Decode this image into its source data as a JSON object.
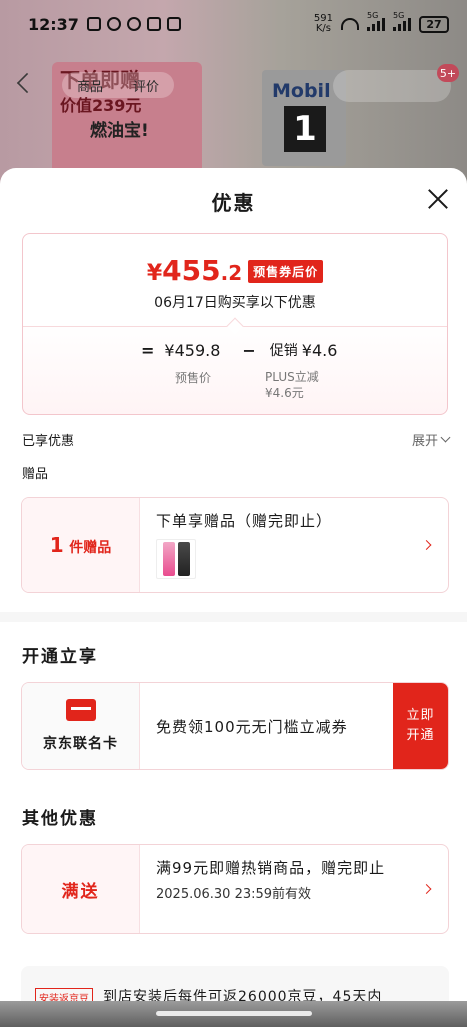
{
  "status_bar": {
    "time": "12:37",
    "net_speed_value": "591",
    "net_speed_unit": "K/s",
    "signal_1_label": "5G",
    "signal_2_label": "5G",
    "battery": "27"
  },
  "background": {
    "tab_product": "商品",
    "tab_review": "评价",
    "promo_line1": "下单即赠",
    "promo_line2": "价值239元",
    "promo_line3": "燃油宝!",
    "brand_text": "Mobil",
    "brand_number": "1",
    "cart_badge": "5+"
  },
  "sheet": {
    "title": "优惠",
    "price_card": {
      "currency": "¥",
      "price_integer": "455",
      "price_decimal": ".2",
      "price_tag": "预售券后价",
      "date_text": "06月17日购买享以下优惠",
      "eq": "=",
      "presale_price": "¥459.8",
      "minus": "−",
      "promo_label": "促销",
      "promo_amount": "¥4.6",
      "presale_label": "预售价",
      "plus_label": "PLUS立减",
      "plus_amount": "¥4.6元"
    },
    "enjoyed_label": "已享优惠",
    "expand_label": "展开",
    "gift_heading": "赠品",
    "gift_card": {
      "count": "1",
      "unit": "件赠品",
      "title": "下单享赠品（赠完即止）"
    },
    "open_section_title": "开通立享",
    "jd_card": {
      "name": "京东联名卡",
      "desc": "免费领100元无门槛立减券",
      "button_line1": "立即",
      "button_line2": "开通"
    },
    "other_section_title": "其他优惠",
    "other_card": {
      "tag": "满送",
      "title": "满99元即赠热销商品，赠完即止",
      "expire": "2025.06.30 23:59前有效"
    },
    "install_card": {
      "tag": "安装返京豆",
      "text": "到店安装后每件可返26000京豆，45天内"
    }
  },
  "colors": {
    "accent_red": "#e1251b",
    "card_border_pink": "#f3d3d7",
    "card_left_bg": "#fff5f6"
  }
}
